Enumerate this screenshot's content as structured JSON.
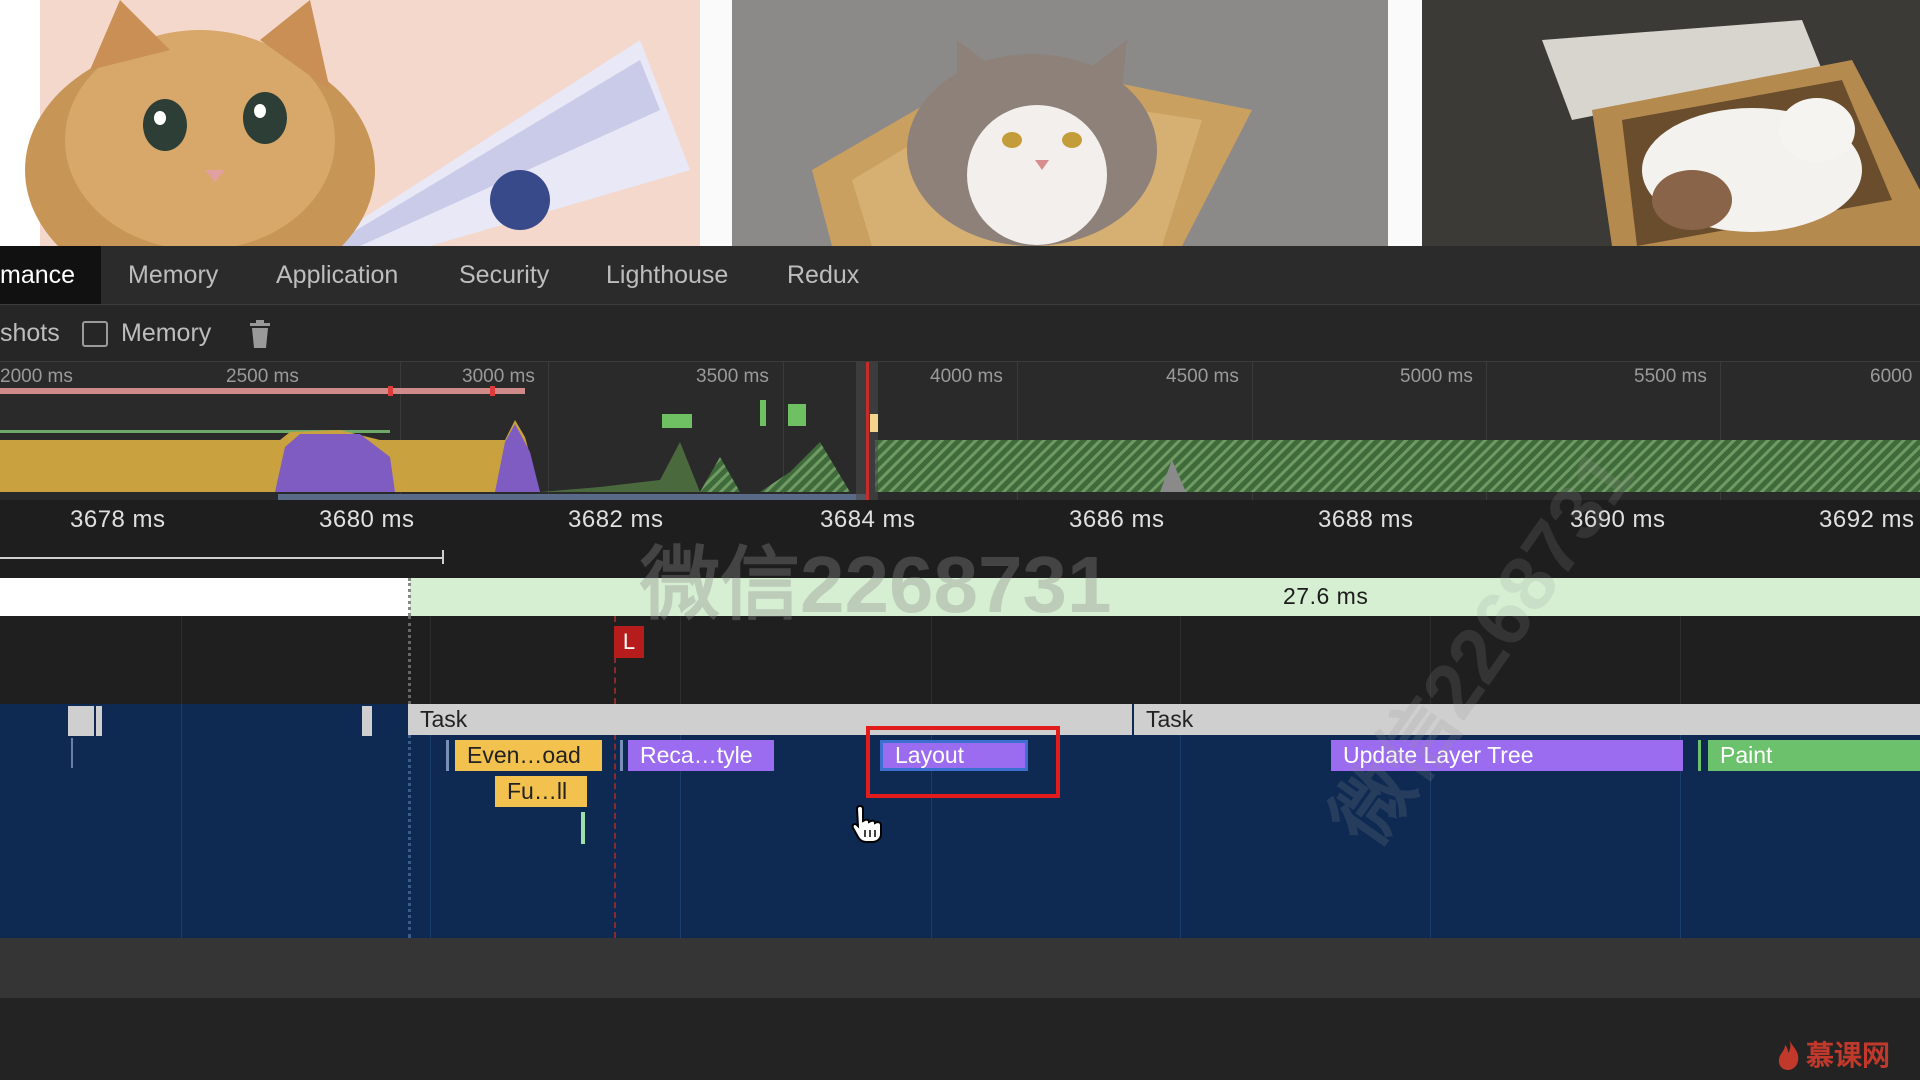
{
  "tabs": [
    {
      "label": "mance",
      "active": true
    },
    {
      "label": "Memory",
      "active": false
    },
    {
      "label": "Application",
      "active": false
    },
    {
      "label": "Security",
      "active": false
    },
    {
      "label": "Lighthouse",
      "active": false
    },
    {
      "label": "Redux",
      "active": false
    }
  ],
  "toolbar": {
    "screenshots_label": "shots",
    "memory_checkbox_label": "Memory",
    "memory_checked": false
  },
  "overview": {
    "ticks": [
      "2000 ms",
      "2500 ms",
      "3000 ms",
      "3500 ms",
      "4000 ms",
      "4500 ms",
      "5000 ms",
      "5500 ms",
      "6000"
    ]
  },
  "ruler": {
    "ticks": [
      "3678 ms",
      "3680 ms",
      "3682 ms",
      "3684 ms",
      "3686 ms",
      "3688 ms",
      "3690 ms",
      "3692 ms"
    ]
  },
  "interaction": {
    "duration": "27.6 ms"
  },
  "marker": {
    "label": "L",
    "color": "#b71c1c"
  },
  "flame": {
    "task1": "Task",
    "task2": "Task",
    "event_load": "Even…oad",
    "function_call": "Fu…ll",
    "recalc_style": "Reca…tyle",
    "layout": "Layout",
    "update_layer_tree": "Update Layer Tree",
    "paint": "Paint"
  },
  "colors": {
    "scripting": "#f2c14e",
    "rendering": "#9b6cf0",
    "painting": "#6cc26c",
    "task": "#cfcfcf",
    "highlight": "#e21b1b"
  },
  "watermark": {
    "wechat": "微信2268731",
    "logo": "慕课网"
  }
}
